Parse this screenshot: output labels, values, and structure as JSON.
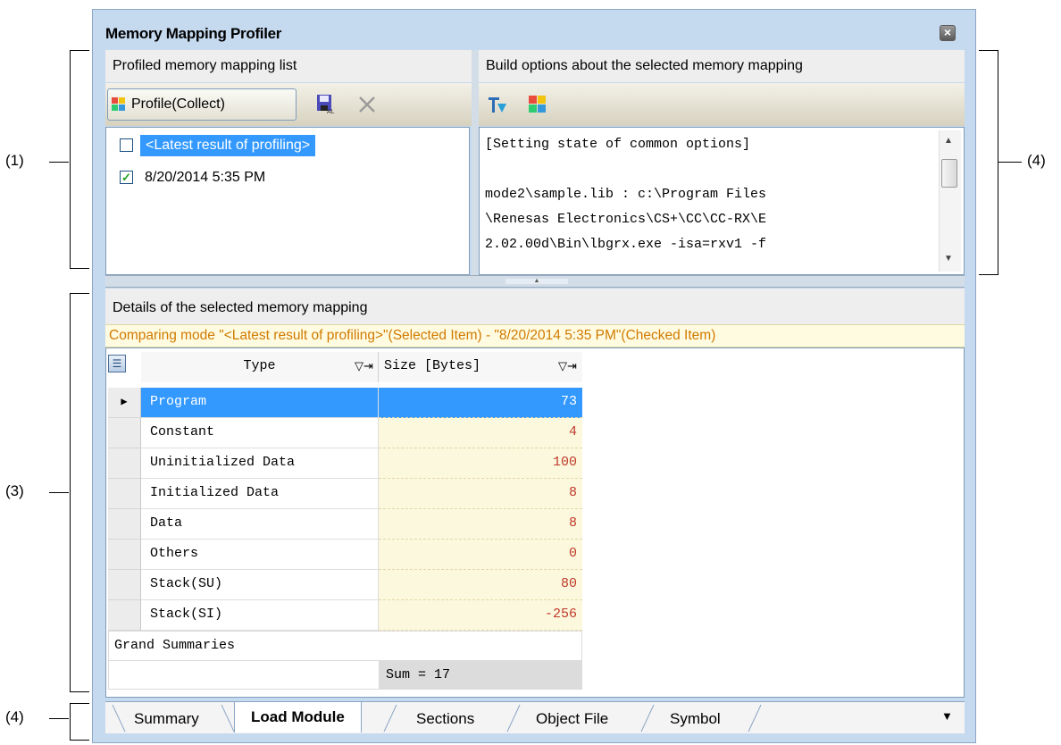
{
  "window": {
    "title": "Memory Mapping Profiler"
  },
  "callouts": [
    "(1)",
    "(4)",
    "(3)",
    "(4)"
  ],
  "left_panel": {
    "header": "Profiled memory mapping list",
    "profile_button": "Profile(Collect)",
    "items": [
      {
        "label": "<Latest result of profiling>",
        "checked": false,
        "selected": true
      },
      {
        "label": "8/20/2014 5:35 PM",
        "checked": true,
        "selected": false
      }
    ]
  },
  "right_panel": {
    "header": "Build options about the selected memory mapping",
    "text_lines": [
      "[Setting state of common options]",
      "",
      "mode2\\sample.lib : c:\\Program Files",
      "\\Renesas Electronics\\CS+\\CC\\CC-RX\\E",
      "2.02.00d\\Bin\\lbgrx.exe -isa=rxv1 -f"
    ]
  },
  "details": {
    "header": "Details of the selected memory mapping",
    "comparing": "Comparing mode \"<Latest result of profiling>\"(Selected Item) - \"8/20/2014 5:35 PM\"(Checked Item)",
    "columns": [
      "Type",
      "Size [Bytes]"
    ],
    "rows": [
      {
        "type": "Program",
        "size": "73"
      },
      {
        "type": "Constant",
        "size": "4"
      },
      {
        "type": "Uninitialized Data",
        "size": "100"
      },
      {
        "type": "Initialized Data",
        "size": "8"
      },
      {
        "type": "Data",
        "size": "8"
      },
      {
        "type": "Others",
        "size": "0"
      },
      {
        "type": "Stack(SU)",
        "size": "80"
      },
      {
        "type": "Stack(SI)",
        "size": "-256"
      }
    ],
    "grand_summaries": "Grand Summaries",
    "sum": "Sum = 17"
  },
  "tabs": [
    "Summary",
    "Load Module",
    "Sections",
    "Object File",
    "Symbol"
  ],
  "active_tab": "Load Module",
  "colors": {
    "selection": "#3399ff",
    "comparing_text": "#d07a00",
    "size_bg": "#fbf8dd"
  }
}
